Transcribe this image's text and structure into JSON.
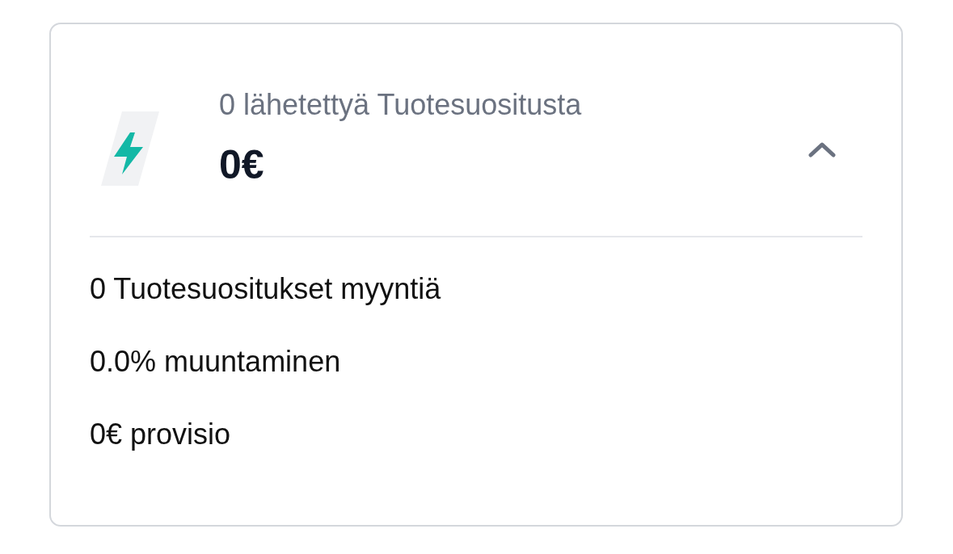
{
  "card": {
    "subtitle": "0 lähetettyä Tuotesuositusta",
    "amount": "0€",
    "expanded": true,
    "stats": [
      "0 Tuotesuositukset myyntiä",
      "0.0% muuntaminen",
      "0€ provisio"
    ]
  }
}
